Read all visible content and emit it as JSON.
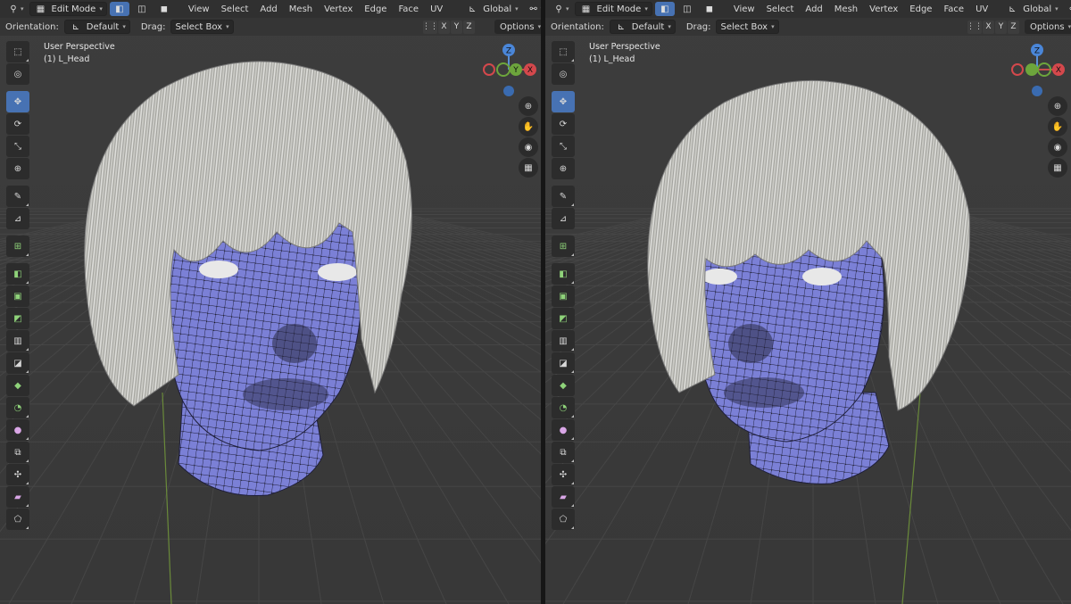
{
  "header": {
    "mode_label": "Edit Mode",
    "menus": [
      "View",
      "Select",
      "Add",
      "Mesh",
      "Vertex",
      "Edge",
      "Face",
      "UV"
    ],
    "transform_orientation": "Global"
  },
  "subheader": {
    "orientation_label": "Orientation:",
    "orientation_value": "Default",
    "drag_label": "Drag:",
    "drag_value": "Select Box",
    "axes": [
      "X",
      "Y",
      "Z"
    ],
    "options_label": "Options"
  },
  "viewport": {
    "perspective": "User Perspective",
    "object": "(1) L_Head"
  },
  "gizmo": {
    "z": "Z",
    "y": "Y",
    "x": "X"
  },
  "colors": {
    "mesh_face": "#7a7fd4",
    "active_tool": "#4772b3",
    "viewport_bg": "#3c3c3c",
    "hair": "#c9c9c4"
  },
  "icons": {
    "tools": [
      "select-box-icon",
      "cursor-icon",
      "move-icon",
      "rotate-icon",
      "scale-icon",
      "transform-icon",
      "annotate-icon",
      "measure-icon",
      "add-cube-icon",
      "extrude-icon",
      "inset-icon",
      "bevel-icon",
      "loop-cut-icon",
      "knife-icon",
      "poly-build-icon",
      "spin-icon",
      "smooth-icon",
      "edge-slide-icon",
      "shrink-fatten-icon",
      "shear-icon",
      "rip-icon"
    ],
    "nav": [
      "zoom-icon",
      "pan-hand-icon",
      "camera-icon",
      "grid-toggle-icon"
    ]
  }
}
